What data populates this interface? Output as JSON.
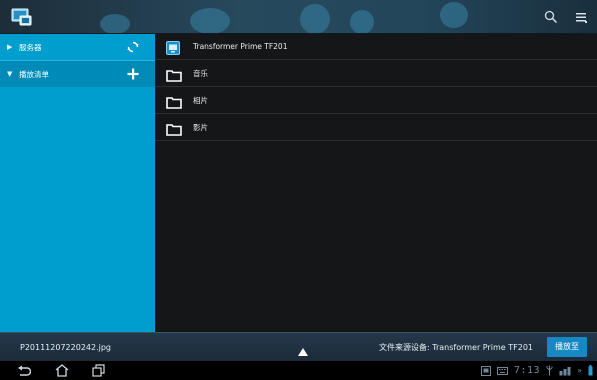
{
  "sidebar": {
    "items": [
      {
        "label": "服务器",
        "arrow": "▶",
        "action_icon": "refresh-icon"
      },
      {
        "label": "播放清单",
        "arrow": "▼",
        "action_icon": "plus-icon"
      }
    ]
  },
  "main": {
    "rows": [
      {
        "label": "Transformer Prime TF201",
        "icon": "device-icon"
      },
      {
        "label": "音乐",
        "icon": "folder-icon"
      },
      {
        "label": "相片",
        "icon": "folder-icon"
      },
      {
        "label": "影片",
        "icon": "folder-icon"
      }
    ]
  },
  "infobar": {
    "filename": "P20111207220242.jpg",
    "source": "文件来源设备: Transformer Prime TF201",
    "play_button": "播放至"
  },
  "status": {
    "clock": "7:13"
  },
  "colors": {
    "accent": "#009dcf",
    "selected": "#008ab8",
    "play_button": "#1588c5",
    "list_background": "#141618"
  }
}
